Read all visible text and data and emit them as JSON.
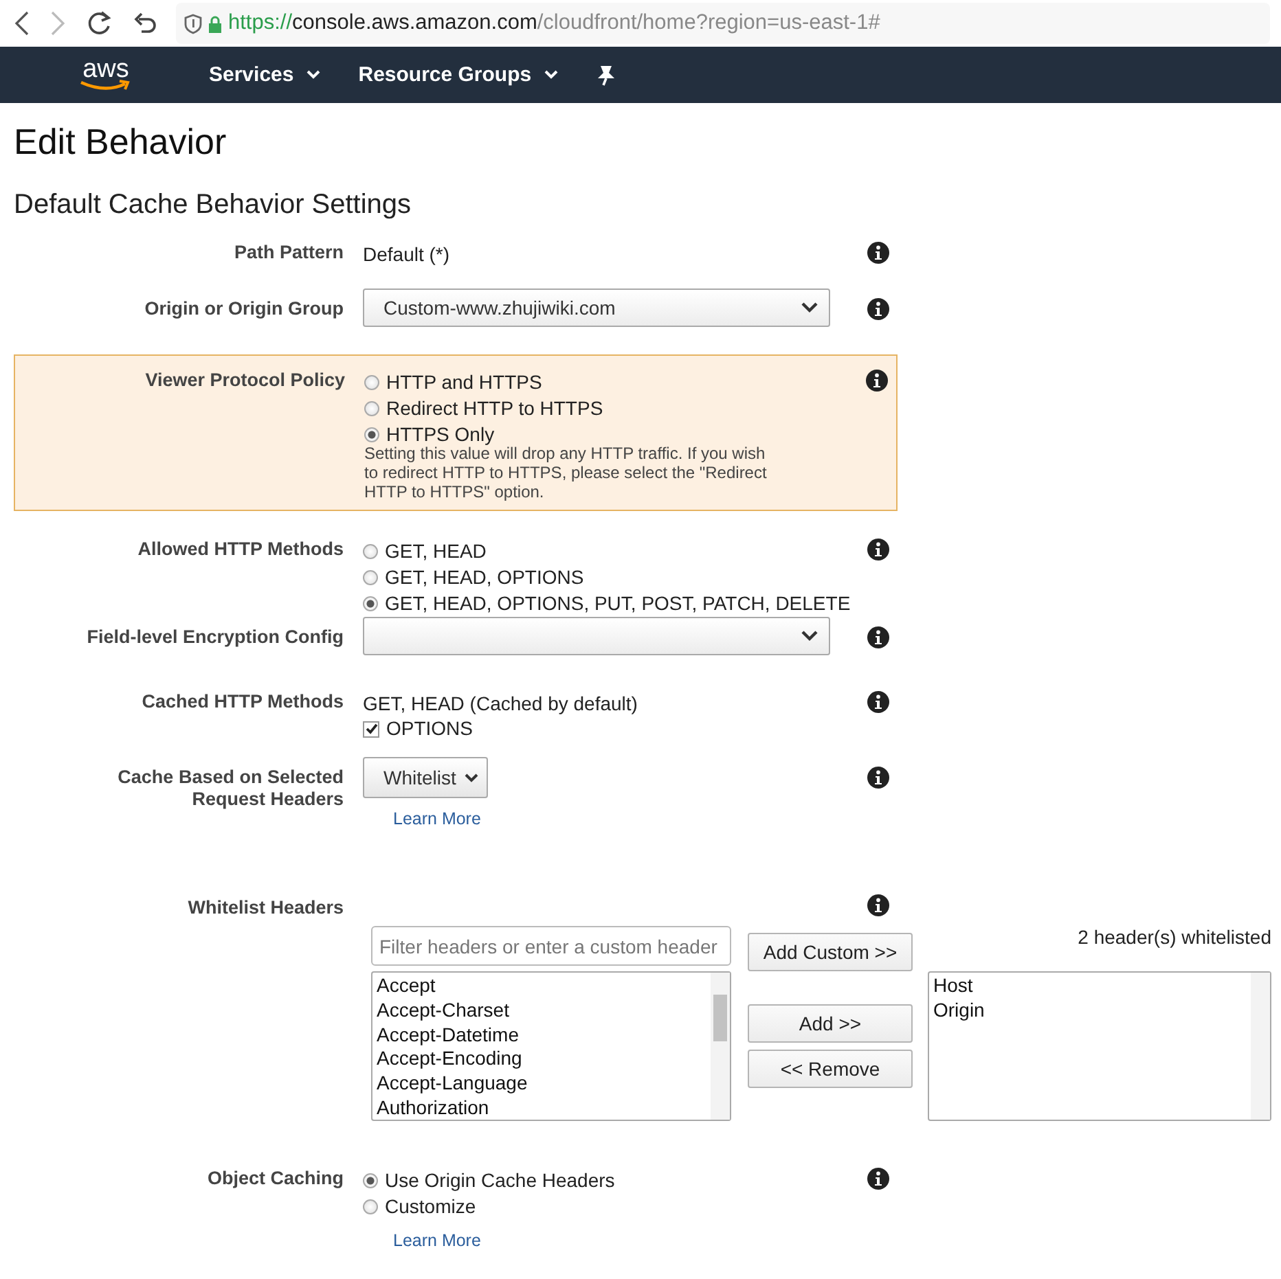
{
  "browser": {
    "url_scheme": "https://",
    "url_host": "console.aws.amazon.com",
    "url_path": "/cloudfront/home?region=us-east-1#"
  },
  "navbar": {
    "logo": "aws",
    "items": [
      {
        "label": "Services",
        "dropdown": true
      },
      {
        "label": "Resource Groups",
        "dropdown": true
      }
    ]
  },
  "page_title": "Edit Behavior",
  "section_title": "Default Cache Behavior Settings",
  "settings": [
    {
      "kind": "text",
      "label": "Path Pattern",
      "value": "Default (*)"
    },
    {
      "kind": "select",
      "label": "Origin or Origin Group",
      "value": "Custom-www.zhujiwiki.com"
    },
    {
      "kind": "radio",
      "label": "Viewer Protocol Policy",
      "highlighted": true,
      "options": [
        {
          "label": "HTTP and HTTPS",
          "selected": false
        },
        {
          "label": "Redirect HTTP to HTTPS",
          "selected": false
        },
        {
          "label": "HTTPS Only",
          "selected": true
        }
      ],
      "note": "Setting this value will drop any HTTP traffic. If you wish to redirect HTTP to HTTPS, please select the \"Redirect HTTP to HTTPS\" option."
    },
    {
      "kind": "radio",
      "label": "Allowed HTTP Methods",
      "options": [
        {
          "label": "GET, HEAD",
          "selected": false
        },
        {
          "label": "GET, HEAD, OPTIONS",
          "selected": false
        },
        {
          "label": "GET, HEAD, OPTIONS, PUT, POST, PATCH, DELETE",
          "selected": true
        }
      ]
    },
    {
      "kind": "select",
      "label": "Field-level Encryption Config"
    },
    {
      "kind": "checkbox",
      "label": "Cached HTTP Methods",
      "text": "GET, HEAD (Cached by default)",
      "options": [
        {
          "label": "OPTIONS",
          "checked": true
        }
      ]
    },
    {
      "kind": "dropdown_button",
      "label": "Cache Based on Selected Request Headers",
      "button": "Whitelist",
      "link": "Learn More"
    },
    {
      "kind": "whitelist",
      "label": "Whitelist Headers",
      "filter_placeholder": "Filter headers or enter a custom header",
      "available": [
        "Accept",
        "Accept-Charset",
        "Accept-Datetime",
        "Accept-Encoding",
        "Accept-Language",
        "Authorization"
      ],
      "buttons": [
        "Add Custom >>",
        "Add >>",
        "<< Remove"
      ],
      "count": "2 header(s) whitelisted",
      "whitelisted": [
        "Host",
        "Origin"
      ]
    },
    {
      "kind": "radio",
      "label": "Object Caching",
      "options": [
        {
          "label": "Use Origin Cache Headers",
          "selected": true
        },
        {
          "label": "Customize",
          "selected": false
        }
      ],
      "link": "Learn More"
    }
  ]
}
